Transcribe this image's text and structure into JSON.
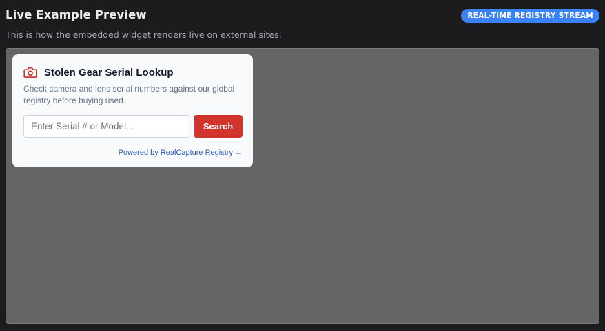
{
  "header": {
    "title": "Live Example Preview",
    "badge": "REAL-TIME REGISTRY STREAM",
    "subtitle": "This is how the embedded widget renders live on external sites:"
  },
  "widget": {
    "icon": "camera-icon",
    "title": "Stolen Gear Serial Lookup",
    "description": "Check camera and lens serial numbers against our global registry before buying used.",
    "search": {
      "placeholder": "Enter Serial # or Model...",
      "value": "",
      "button_label": "Search"
    },
    "powered_by": "Powered by RealCapture Registry →"
  },
  "colors": {
    "badge": "#3b82f6",
    "search_button": "#d0342c",
    "camera_icon": "#d0342c",
    "link": "#2d5bb9",
    "preview_background": "#656565"
  }
}
